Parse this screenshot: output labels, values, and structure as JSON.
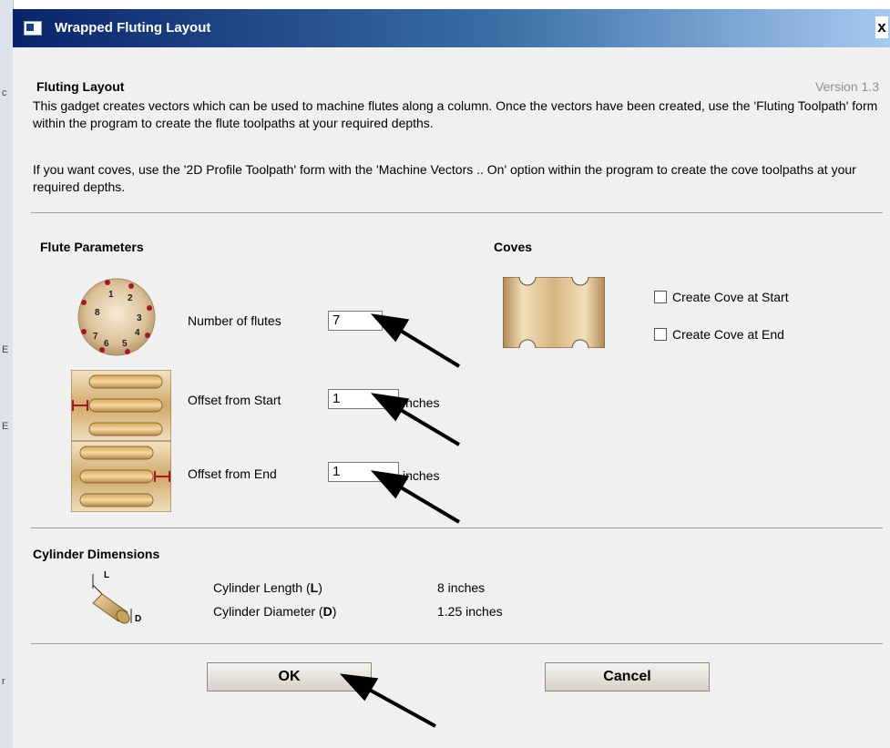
{
  "window": {
    "title": "Wrapped Fluting Layout",
    "close_label": "x"
  },
  "header": {
    "heading": "Fluting Layout",
    "version": "Version 1.3",
    "description_1": "This gadget creates vectors which can be used to machine flutes along a column. Once the vectors have been created, use the 'Fluting Toolpath' form within the program to create the flute toolpaths at your required depths.",
    "description_2": "If you want coves, use the '2D Profile Toolpath' form with the 'Machine Vectors .. On' option within the program to create the cove toolpaths at your required depths."
  },
  "flute_parameters": {
    "heading": "Flute Parameters",
    "number_of_flutes_label": "Number of flutes",
    "number_of_flutes_value": "7",
    "offset_start_label": "Offset from Start",
    "offset_start_value": "1",
    "offset_start_unit": "inches",
    "offset_end_label": "Offset from End",
    "offset_end_value": "1",
    "offset_end_unit": "inches",
    "diagram_numbers": [
      "1",
      "2",
      "3",
      "4",
      "5",
      "6",
      "7",
      "8"
    ]
  },
  "coves": {
    "heading": "Coves",
    "create_start_label": "Create Cove at Start",
    "create_end_label": "Create Cove at End",
    "create_start_checked": false,
    "create_end_checked": false
  },
  "cylinder": {
    "heading": "Cylinder Dimensions",
    "length_label_prefix": "Cylinder Length (",
    "length_label_letter": "L",
    "length_label_suffix": ")",
    "length_value": "8  inches",
    "diameter_label_prefix": "Cylinder Diameter (",
    "diameter_label_letter": "D",
    "diameter_label_suffix": ")",
    "diameter_value": "1.25  inches",
    "icon_letter_l": "L",
    "icon_letter_d": "D"
  },
  "buttons": {
    "ok": "OK",
    "cancel": "Cancel"
  },
  "left_strip_glyphs": [
    "c",
    "E",
    "E",
    "r"
  ],
  "colors": {
    "title_start": "#0a246a",
    "title_end": "#a6caf0",
    "wood": "#d9b97c",
    "wood_dark": "#a07a3c",
    "marker": "#a3182b"
  }
}
